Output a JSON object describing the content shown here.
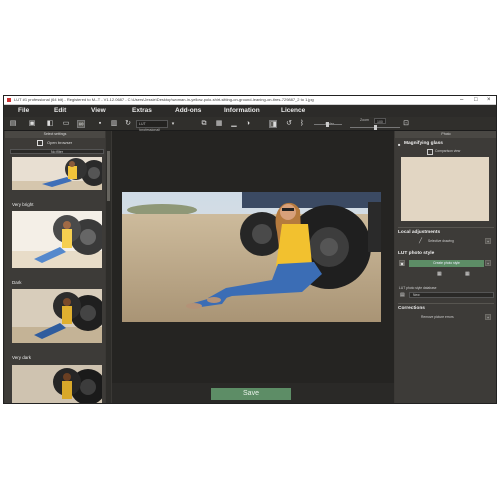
{
  "window": {
    "title": "LUT #1 professional (64 bit) - Registered to M--T - V1.12.0687 - C:\\Users\\Jessie\\Desktop\\woman-in-yellow-polo-shirt-sitting-on-ground-leaning-on-tires-729887_2 to 1.jpg"
  },
  "menu": [
    "File",
    "Edit",
    "View",
    "Extras",
    "Add-ons",
    "Information",
    "Licence"
  ],
  "toolbar": {
    "lut_select": "LUT (professional)",
    "zoom_label": "Zoom",
    "zoom_value": "100",
    "slider_label": "Slider"
  },
  "left_panel": {
    "header": "Select settings",
    "preset_button": "Open browser",
    "filter_value": "No filter",
    "thumbnails": [
      {
        "label": ""
      },
      {
        "label": "Very bright"
      },
      {
        "label": "Dark"
      },
      {
        "label": "Very dark"
      }
    ]
  },
  "center": {
    "save_label": "Save"
  },
  "right_panel": {
    "header": "Photo",
    "magnifying_glass": "Magnifying glass",
    "compare_label": "Comparison view",
    "local_adjustments": "Local adjustments",
    "selective_drawing": "Selective drawing",
    "lut_photo_style": "LUT photo style",
    "create_button": "Create photo style",
    "lut_database": "LUT photo style database",
    "db_value": "New",
    "corrections": "Corrections",
    "remove_errors": "Remove picture errors"
  },
  "colors": {
    "accent_green": "#5d8d66",
    "panel_bg": "#3d3b38",
    "canvas_bg": "#252422"
  }
}
